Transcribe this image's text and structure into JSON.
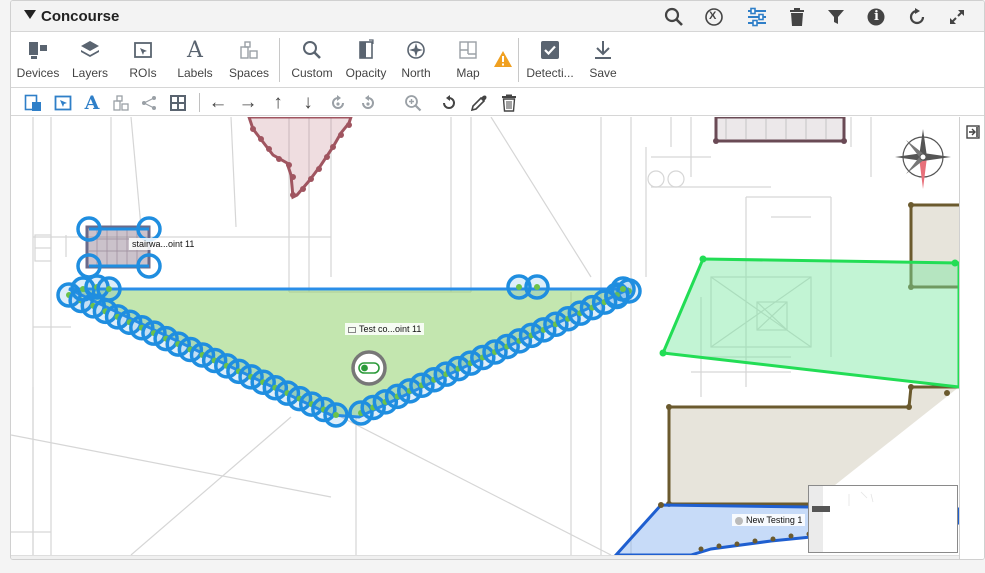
{
  "panel": {
    "title": "Concourse"
  },
  "title_actions": [
    {
      "name": "search-icon"
    },
    {
      "name": "clear-icon",
      "glyph": "X"
    },
    {
      "name": "sliders-icon"
    },
    {
      "name": "trash-icon"
    },
    {
      "name": "filter-icon"
    },
    {
      "name": "info-icon",
      "glyph": "i"
    },
    {
      "name": "refresh-icon"
    },
    {
      "name": "expand-icon"
    }
  ],
  "toolbar": {
    "devices": "Devices",
    "layers": "Layers",
    "rois": "ROIs",
    "labels": "Labels",
    "labels_glyph": "A",
    "spaces": "Spaces",
    "custom": "Custom",
    "opacity": "Opacity",
    "north": "North",
    "map": "Map",
    "detection": "Detecti...",
    "save": "Save"
  },
  "toolbar2": {
    "text_glyph": "A",
    "arrow_left": "←",
    "arrow_right": "→",
    "arrow_up": "↑",
    "arrow_down": "↓"
  },
  "map": {
    "roi_label_1": "stairwa...oint 11",
    "roi_label_2": "Test co...oint 11",
    "space_label": "New Testing 1"
  },
  "colors": {
    "accent_blue": "#1f8ee0",
    "handle_green": "#6cc24a",
    "green_zone": "#22dd55",
    "maroon": "#a05560",
    "olive": "#6b5a2e",
    "warning": "#f0a020"
  }
}
